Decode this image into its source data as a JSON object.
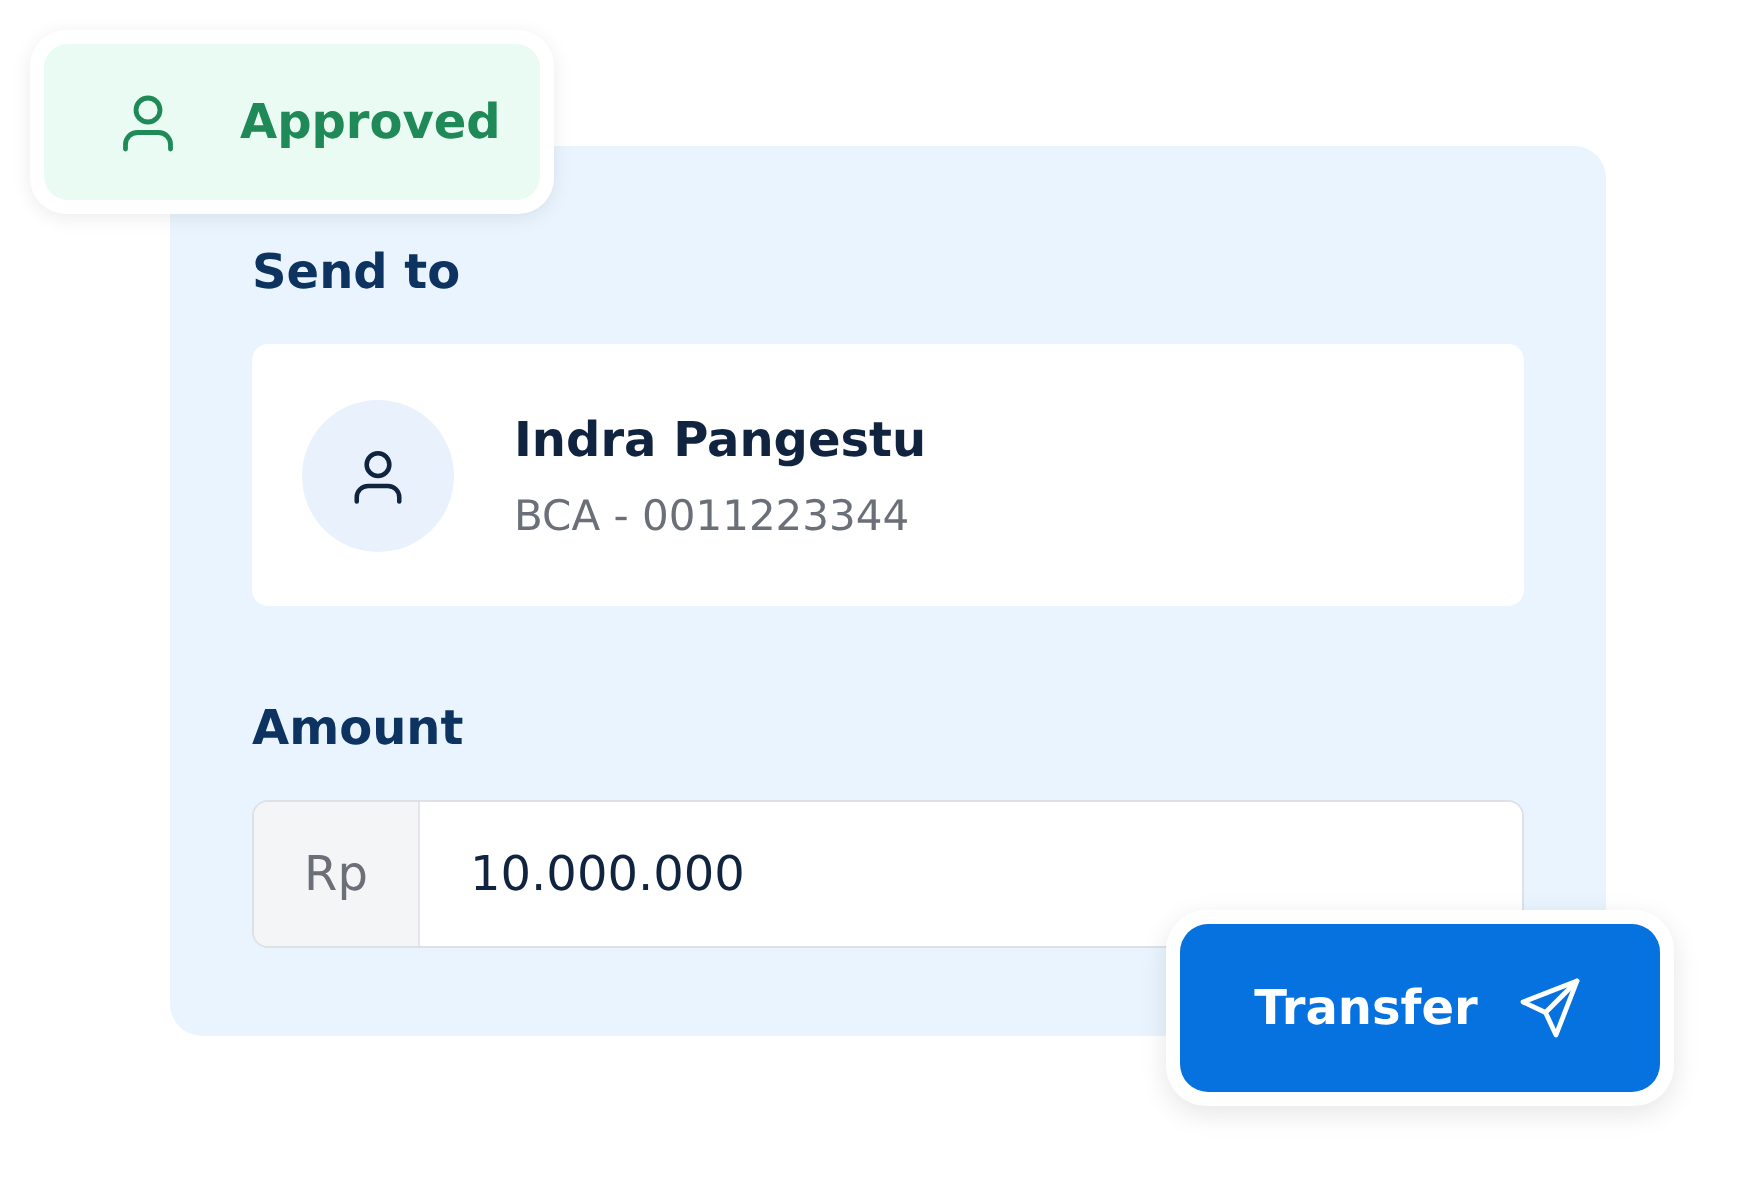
{
  "status_badge": {
    "label": "Approved"
  },
  "recipient_section": {
    "label": "Send to",
    "name": "Indra Pangestu",
    "account": "BCA - 0011223344"
  },
  "amount_section": {
    "label": "Amount",
    "currency": "Rp",
    "value": "10.000.000"
  },
  "transfer_button": {
    "label": "Transfer"
  }
}
